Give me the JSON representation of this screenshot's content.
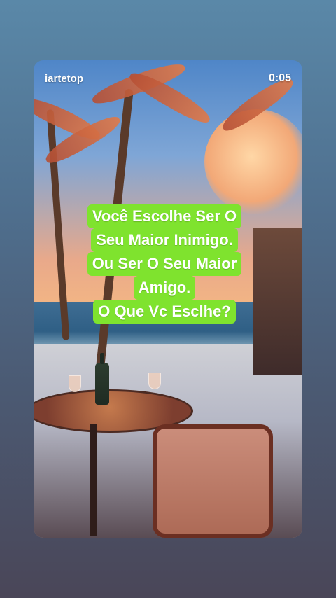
{
  "overlay": {
    "username": "iartetop",
    "timer": "0:05"
  },
  "caption": {
    "lines": [
      "Você Escolhe Ser O",
      "Seu Maior Inimigo.",
      "Ou Ser O Seu Maior",
      "Amigo.",
      "O Que Vc Esclhe?"
    ],
    "background_color": "#7fe32e",
    "text_color": "#ffffff"
  },
  "background_image": {
    "description_icon": "beach-cafe-illustration"
  }
}
